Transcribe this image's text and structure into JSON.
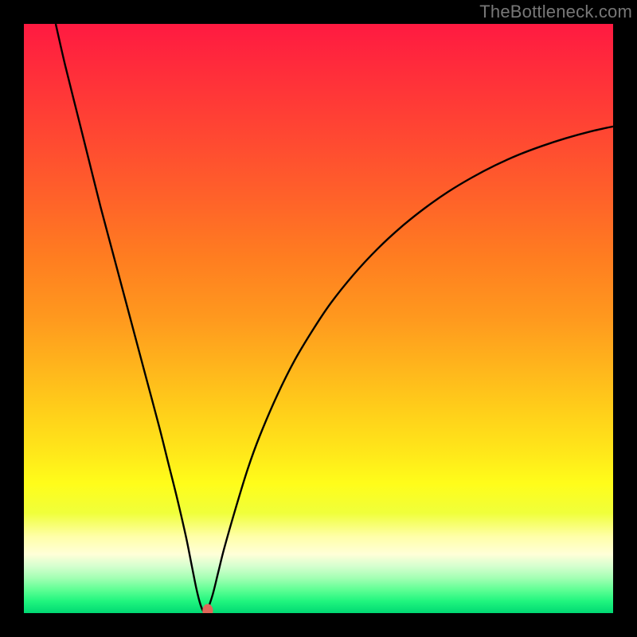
{
  "watermark": "TheBottleneck.com",
  "chart_data": {
    "type": "line",
    "title": "",
    "xlabel": "",
    "ylabel": "",
    "xlim": [
      0,
      100
    ],
    "ylim": [
      0,
      100
    ],
    "grid": false,
    "legend": false,
    "curve": {
      "name": "bottleneck-curve",
      "color": "#000000",
      "x": [
        5.4,
        7,
        9,
        11,
        13,
        15,
        17,
        19,
        21,
        23,
        24.5,
        26,
        27.5,
        28.5,
        29.2,
        29.8,
        30.2,
        30.5,
        30.7,
        31,
        32,
        33,
        34,
        36,
        38,
        40,
        43,
        46,
        49,
        52,
        56,
        60,
        64,
        68,
        72,
        76,
        80,
        84,
        88,
        92,
        96,
        100
      ],
      "y": [
        100,
        93,
        85,
        77,
        69,
        61.5,
        54,
        46.5,
        39,
        31.5,
        25.5,
        19.5,
        13,
        8,
        4.5,
        2,
        0.8,
        0.25,
        0.25,
        0.25,
        3,
        7,
        11,
        18,
        24.5,
        30,
        37,
        43,
        48,
        52.5,
        57.5,
        61.8,
        65.5,
        68.7,
        71.5,
        73.9,
        76,
        77.8,
        79.3,
        80.6,
        81.7,
        82.6
      ]
    },
    "marker": {
      "name": "optimum-point",
      "x": 31.2,
      "y": 0.4,
      "rx": 0.9,
      "ry": 1.15,
      "color": "#e06659"
    },
    "background_gradient": {
      "type": "vertical",
      "stops": [
        {
          "offset": 0.0,
          "color": "#ff1a41"
        },
        {
          "offset": 0.1,
          "color": "#ff3239"
        },
        {
          "offset": 0.2,
          "color": "#ff4a31"
        },
        {
          "offset": 0.3,
          "color": "#ff6329"
        },
        {
          "offset": 0.4,
          "color": "#ff7e20"
        },
        {
          "offset": 0.5,
          "color": "#ff991e"
        },
        {
          "offset": 0.58,
          "color": "#ffb41c"
        },
        {
          "offset": 0.66,
          "color": "#ffd01a"
        },
        {
          "offset": 0.73,
          "color": "#ffe81a"
        },
        {
          "offset": 0.78,
          "color": "#fffd1a"
        },
        {
          "offset": 0.83,
          "color": "#f0ff3a"
        },
        {
          "offset": 0.87,
          "color": "#ffffa8"
        },
        {
          "offset": 0.9,
          "color": "#ffffd8"
        },
        {
          "offset": 0.92,
          "color": "#d6ffcf"
        },
        {
          "offset": 0.94,
          "color": "#a4ffb4"
        },
        {
          "offset": 0.96,
          "color": "#60ff95"
        },
        {
          "offset": 0.98,
          "color": "#20f57e"
        },
        {
          "offset": 1.0,
          "color": "#00d873"
        }
      ]
    }
  }
}
